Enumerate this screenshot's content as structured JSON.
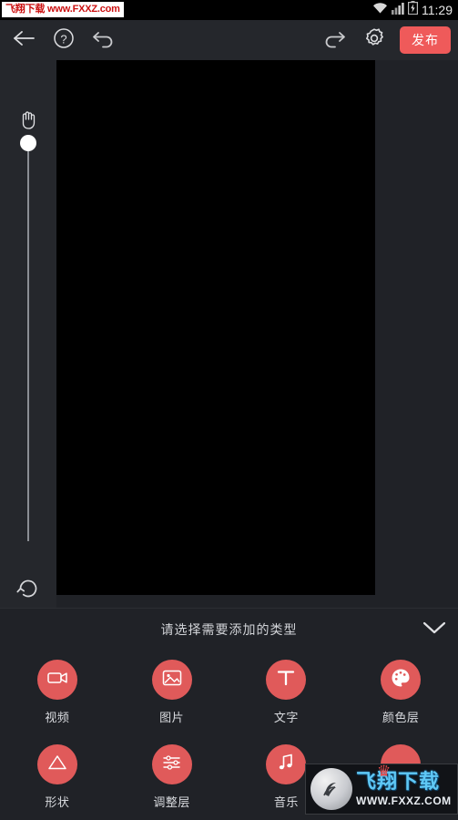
{
  "statusbar": {
    "watermark_text": "飞翔下载 www.FXXZ.com",
    "clock": "11:29",
    "icons": [
      "wifi-icon",
      "signal-icon",
      "battery-charging-icon"
    ]
  },
  "toolbar": {
    "back_icon": "back-arrow-icon",
    "help_icon": "question-circle-icon",
    "undo_icon": "undo-icon",
    "redo_icon": "redo-icon",
    "settings_icon": "gear-icon",
    "publish_label": "发布"
  },
  "editor": {
    "hand_icon": "hand-icon",
    "slider": {
      "name": "zoom-slider",
      "value": 100
    },
    "reset_icon": "reset-rotate-icon",
    "play_icon": "play-icon",
    "canvas_color": "#000000"
  },
  "panel": {
    "title": "请选择需要添加的类型",
    "collapse_icon": "chevron-down-icon",
    "accent_color": "#e05a5a",
    "items": [
      {
        "label": "视频",
        "icon": "video-camera-icon"
      },
      {
        "label": "图片",
        "icon": "picture-icon"
      },
      {
        "label": "文字",
        "icon": "text-t-icon"
      },
      {
        "label": "颜色层",
        "icon": "color-palette-icon"
      },
      {
        "label": "形状",
        "icon": "triangle-shape-icon"
      },
      {
        "label": "调整层",
        "icon": "sliders-adjust-icon"
      },
      {
        "label": "音乐",
        "icon": "music-note-icon"
      },
      {
        "label": "",
        "icon": "obscured-icon"
      }
    ]
  },
  "bottom_watermark": {
    "logo_icon": "fxxz-logo-icon",
    "brand": "飞翔下载",
    "url": "WWW.FXXZ.COM"
  }
}
